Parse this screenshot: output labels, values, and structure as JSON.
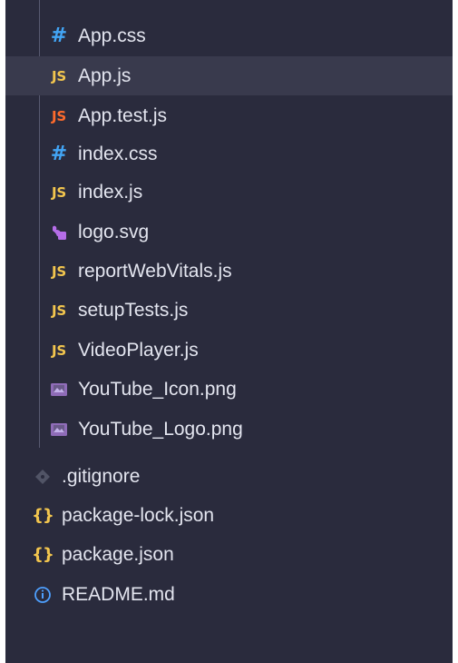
{
  "explorer": {
    "items": [
      {
        "label": "App.css",
        "icon": "css-hash-icon"
      },
      {
        "label": "App.js",
        "icon": "js-icon",
        "selected": true
      },
      {
        "label": "App.test.js",
        "icon": "js-test-icon"
      },
      {
        "label": "index.css",
        "icon": "css-hash-icon"
      },
      {
        "label": "index.js",
        "icon": "js-icon"
      },
      {
        "label": "logo.svg",
        "icon": "svg-icon"
      },
      {
        "label": "reportWebVitals.js",
        "icon": "js-icon"
      },
      {
        "label": "setupTests.js",
        "icon": "js-icon"
      },
      {
        "label": "VideoPlayer.js",
        "icon": "js-icon"
      },
      {
        "label": "YouTube_Icon.png",
        "icon": "image-icon"
      },
      {
        "label": "YouTube_Logo.png",
        "icon": "image-icon"
      },
      {
        "label": ".gitignore",
        "icon": "gitignore-icon"
      },
      {
        "label": "package-lock.json",
        "icon": "json-braces-icon"
      },
      {
        "label": "package.json",
        "icon": "json-braces-icon"
      },
      {
        "label": "README.md",
        "icon": "info-icon"
      }
    ]
  },
  "icons": {
    "css_hash_glyph": "#",
    "js_glyph": "JS",
    "json_glyph": "{}"
  },
  "colors": {
    "panel_background": "#2a2b3d",
    "selected_row": "#393a4d",
    "text": "#e3e5ef",
    "css_icon": "#42a5f5",
    "js_icon": "#f3c64e",
    "js_test_icon": "#ff6b2c"
  }
}
